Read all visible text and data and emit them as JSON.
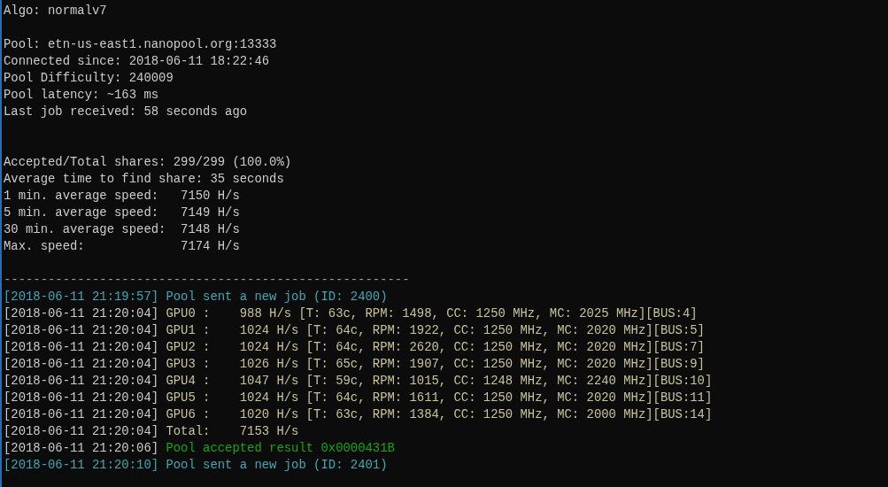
{
  "lines": [
    {
      "kind": "plain",
      "text": "Algo: normalv7"
    },
    {
      "kind": "blank"
    },
    {
      "kind": "plain",
      "text": "Pool: etn-us-east1.nanopool.org:13333"
    },
    {
      "kind": "plain",
      "text": "Connected since: 2018-06-11 18:22:46"
    },
    {
      "kind": "plain",
      "text": "Pool Difficulty: 240009"
    },
    {
      "kind": "plain",
      "text": "Pool latency: ~163 ms"
    },
    {
      "kind": "plain",
      "text": "Last job received: 58 seconds ago"
    },
    {
      "kind": "blank"
    },
    {
      "kind": "blank"
    },
    {
      "kind": "plain",
      "text": "Accepted/Total shares: 299/299 (100.0%)"
    },
    {
      "kind": "plain",
      "text": "Average time to find share: 35 seconds"
    },
    {
      "kind": "plain",
      "text": "1 min. average speed:   7150 H/s"
    },
    {
      "kind": "plain",
      "text": "5 min. average speed:   7149 H/s"
    },
    {
      "kind": "plain",
      "text": "30 min. average speed:  7148 H/s"
    },
    {
      "kind": "plain",
      "text": "Max. speed:             7174 H/s"
    },
    {
      "kind": "blank"
    },
    {
      "kind": "rule",
      "text": "-------------------------------------------------------"
    },
    {
      "kind": "info",
      "time": "[2018-06-11 21:19:57]",
      "message": "Pool sent a new job (ID: 2400)"
    },
    {
      "kind": "gpu",
      "time": "[2018-06-11 21:20:04]",
      "message": "GPU0 :    988 H/s [T: 63c, RPM: 1498, CC: 1250 MHz, MC: 2025 MHz][BUS:4]"
    },
    {
      "kind": "gpu",
      "time": "[2018-06-11 21:20:04]",
      "message": "GPU1 :    1024 H/s [T: 64c, RPM: 1922, CC: 1250 MHz, MC: 2020 MHz][BUS:5]"
    },
    {
      "kind": "gpu",
      "time": "[2018-06-11 21:20:04]",
      "message": "GPU2 :    1024 H/s [T: 64c, RPM: 2620, CC: 1250 MHz, MC: 2020 MHz][BUS:7]"
    },
    {
      "kind": "gpu",
      "time": "[2018-06-11 21:20:04]",
      "message": "GPU3 :    1026 H/s [T: 65c, RPM: 1907, CC: 1250 MHz, MC: 2020 MHz][BUS:9]"
    },
    {
      "kind": "gpu",
      "time": "[2018-06-11 21:20:04]",
      "message": "GPU4 :    1047 H/s [T: 59c, RPM: 1015, CC: 1248 MHz, MC: 2240 MHz][BUS:10]"
    },
    {
      "kind": "gpu",
      "time": "[2018-06-11 21:20:04]",
      "message": "GPU5 :    1024 H/s [T: 64c, RPM: 1611, CC: 1250 MHz, MC: 2020 MHz][BUS:11]"
    },
    {
      "kind": "gpu",
      "time": "[2018-06-11 21:20:04]",
      "message": "GPU6 :    1020 H/s [T: 63c, RPM: 1384, CC: 1250 MHz, MC: 2000 MHz][BUS:14]"
    },
    {
      "kind": "gpu",
      "time": "[2018-06-11 21:20:04]",
      "message": "Total:    7153 H/s"
    },
    {
      "kind": "accepted",
      "time": "[2018-06-11 21:20:06]",
      "message": "Pool accepted result 0x0000431B"
    },
    {
      "kind": "info",
      "time": "[2018-06-11 21:20:10]",
      "message": "Pool sent a new job (ID: 2401)"
    }
  ]
}
